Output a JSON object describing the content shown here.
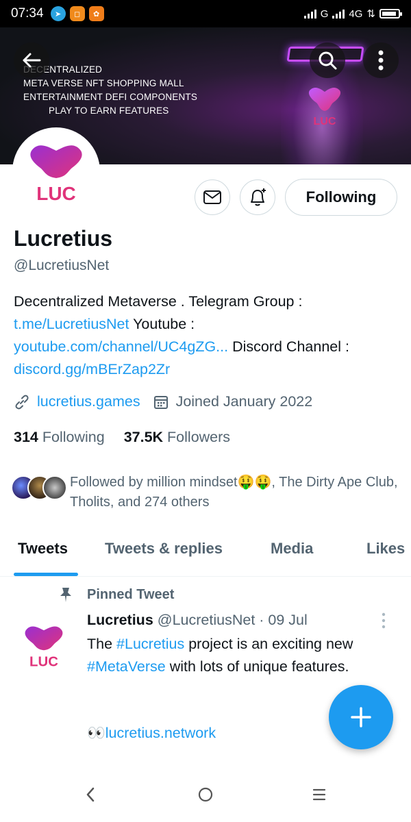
{
  "status_bar": {
    "time": "07:34",
    "network": "G",
    "network2": "4G",
    "data_arrows": "⇅"
  },
  "banner": {
    "lines": [
      "DECENTRALIZED",
      "META VERSE  NFT SHOPPING MALL",
      "ENTERTAINMENT  DEFI COMPONENTS",
      "PLAY TO EARN FEATURES"
    ],
    "logo_text": "LUC"
  },
  "profile": {
    "name": "Lucretius",
    "handle": "@LucretiusNet",
    "follow_label": "Following",
    "bio": {
      "t1": "Decentralized Metaverse .  Telegram Group : ",
      "l1": "t.me/LucretiusNet",
      "t2": " Youtube : ",
      "l2": "youtube.com/channel/UC4gZG...",
      "t3": " Discord Channel : ",
      "l3": "discord.gg/mBErZap2Zr"
    },
    "website": "lucretius.games",
    "joined": "Joined January 2022",
    "following_count": "314",
    "following_label": "Following",
    "followers_count": "37.5K",
    "followers_label": "Followers",
    "followed_by": "Followed by million mindset🤑🤑, The Dirty Ape Club, Tholits, and 274 others"
  },
  "tabs": [
    {
      "label": "Tweets",
      "active": true
    },
    {
      "label": "Tweets & replies",
      "active": false
    },
    {
      "label": "Media",
      "active": false
    },
    {
      "label": "Likes",
      "active": false
    }
  ],
  "pinned_label": "Pinned Tweet",
  "tweet": {
    "name": "Lucretius",
    "handle": "@LucretiusNet",
    "date": "09 Jul",
    "sep": " · ",
    "b1": "The ",
    "h1": "#Lucretius",
    "b2": " project is an exciting new ",
    "h2": "#MetaVerse",
    "b3": " with lots of unique features.",
    "eyes": "👀",
    "link": "lucretius.network"
  },
  "colors": {
    "accent": "#1d9bf0",
    "brand_purple": "#8e2bbf",
    "brand_pink": "#e0337a"
  }
}
